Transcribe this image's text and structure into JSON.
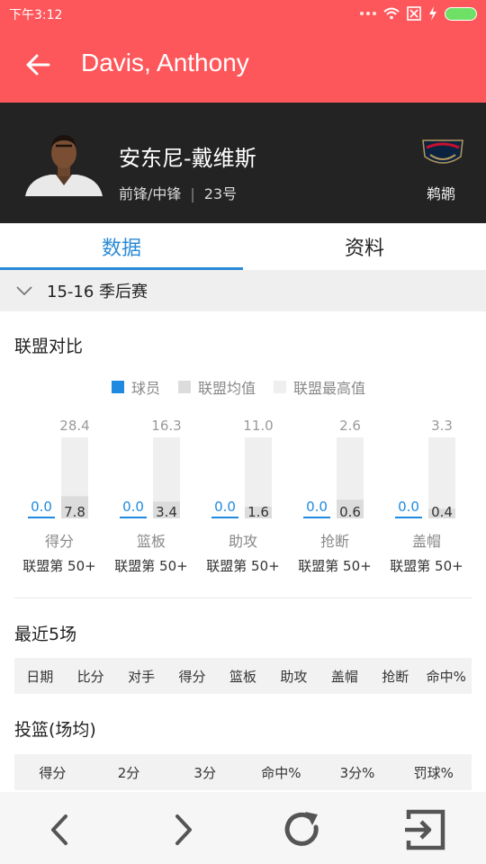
{
  "status_bar": {
    "time": "下午3:12"
  },
  "app_bar": {
    "title": "Davis, Anthony"
  },
  "player": {
    "name": "安东尼-戴维斯",
    "position": "前锋/中锋",
    "number": "23号",
    "team": "鹈鹕"
  },
  "tabs": [
    {
      "label": "数据",
      "active": true
    },
    {
      "label": "资料",
      "active": false
    }
  ],
  "season": {
    "label": "15-16 季后赛"
  },
  "league_compare": {
    "title": "联盟对比",
    "legend": [
      {
        "label": "球员",
        "color": "#1f8ae0"
      },
      {
        "label": "联盟均值",
        "color": "#dcdcdc"
      },
      {
        "label": "联盟最高值",
        "color": "#efefef"
      }
    ]
  },
  "chart_data": {
    "type": "bar",
    "categories": [
      "得分",
      "篮板",
      "助攻",
      "抢断",
      "盖帽"
    ],
    "series": [
      {
        "name": "球员",
        "values": [
          0.0,
          0.0,
          0.0,
          0.0,
          0.0
        ]
      },
      {
        "name": "联盟均值",
        "values": [
          7.8,
          3.4,
          1.6,
          0.6,
          0.4
        ]
      },
      {
        "name": "联盟最高值",
        "values": [
          28.4,
          16.3,
          11.0,
          2.6,
          3.3
        ]
      }
    ],
    "value_labels": {
      "player": [
        "0.0",
        "0.0",
        "0.0",
        "0.0",
        "0.0"
      ],
      "avg": [
        "7.8",
        "3.4",
        "1.6",
        "0.6",
        "0.4"
      ],
      "max": [
        "28.4",
        "16.3",
        "11.0",
        "2.6",
        "3.3"
      ]
    },
    "ranks": [
      "联盟第 50+",
      "联盟第 50+",
      "联盟第 50+",
      "联盟第 50+",
      "联盟第 50+"
    ],
    "colors": {
      "player": "#1f8ae0",
      "avg": "#dcdcdc",
      "max": "#efefef"
    }
  },
  "recent": {
    "title": "最近5场",
    "columns": [
      "日期",
      "比分",
      "对手",
      "得分",
      "篮板",
      "助攻",
      "盖帽",
      "抢断",
      "命中%"
    ]
  },
  "shooting": {
    "title": "投篮(场均)",
    "columns": [
      "得分",
      "2分",
      "3分",
      "命中%",
      "3分%",
      "罚球%"
    ]
  },
  "bottom_nav": {
    "icons": [
      "chevron-left-icon",
      "chevron-right-icon",
      "refresh-icon",
      "exit-icon"
    ]
  }
}
